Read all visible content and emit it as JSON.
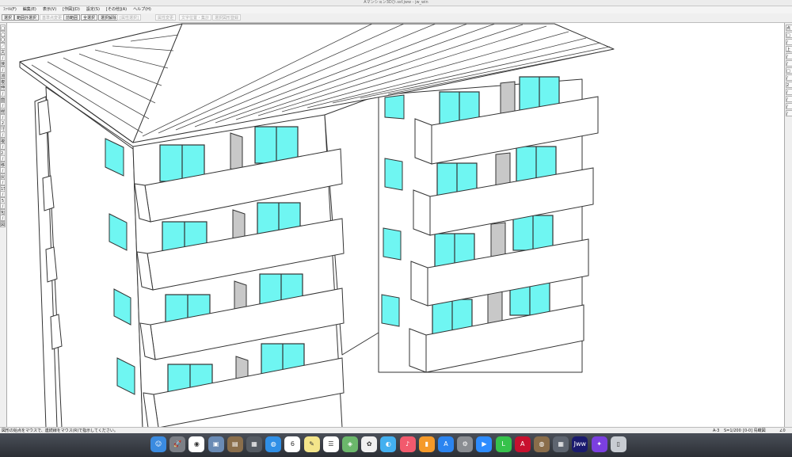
{
  "window": {
    "title": "Aマンション3Dひ.ssf.jww - jw_win"
  },
  "menu": [
    "ﾌｧｲﾙ(F)",
    "編集(E)",
    "表示(V)",
    "[作図](D)",
    "設定(S)",
    "[その他](A)",
    "ヘルプ(H)"
  ],
  "toolbar": {
    "items": [
      {
        "label": "選択",
        "disabled": false
      },
      {
        "label": "範囲外選択",
        "disabled": false
      },
      {
        "label": "基準点変更",
        "disabled": true
      },
      {
        "label": "前範囲",
        "disabled": false
      },
      {
        "label": "全選択",
        "disabled": false
      },
      {
        "label": "選択解除",
        "disabled": false
      },
      {
        "label": "[属性選択]",
        "disabled": true
      },
      {
        "label": "属性変更",
        "disabled": true
      },
      {
        "label": "文字位置・集計",
        "disabled": true
      },
      {
        "label": "選択図形登録",
        "disabled": true
      }
    ]
  },
  "left_tools": [
    "□",
    "◯",
    "〇",
    "／",
    "文",
    "/",
    "接",
    "/",
    "消",
    "複",
    "伸",
    "/",
    "面",
    "/",
    "線",
    "/",
    "2",
    "寸",
    "/",
    "複",
    "/",
    "2.5",
    "/",
    "移",
    "/",
    "戻",
    "/",
    "15",
    "/",
    "5",
    "/",
    "包",
    "/",
    "図"
  ],
  "right_tools": [
    "点",
    "□",
    "/",
    "上",
    "/",
    "/",
    "□",
    "/",
    "2",
    "/",
    "/",
    "/",
    "/"
  ],
  "status": {
    "message": "図形の始点をマウスで、連続線をマウス(R)で指示してください。",
    "scale": "A-3",
    "scale_ratio": "S=1/200",
    "layer": "[0-0] 鳥瞰図",
    "angle": "∠0"
  },
  "dock": {
    "apps": [
      {
        "name": "finder-icon",
        "label": "☺",
        "color": "#3b8be0"
      },
      {
        "name": "launchpad-icon",
        "label": "🚀",
        "color": "#7c7f86"
      },
      {
        "name": "chrome-icon",
        "label": "◉",
        "color": "#ffffff"
      },
      {
        "name": "preview-icon",
        "label": "▣",
        "color": "#6a8bb5"
      },
      {
        "name": "notes-icon",
        "label": "▤",
        "color": "#8a6e4b"
      },
      {
        "name": "doc-icon",
        "label": "▦",
        "color": "#555b63"
      },
      {
        "name": "safari-icon",
        "label": "◍",
        "color": "#2f8fe6"
      },
      {
        "name": "calendar-icon",
        "label": "6",
        "color": "#ffffff"
      },
      {
        "name": "notes2-icon",
        "label": "✎",
        "color": "#f4e58a"
      },
      {
        "name": "reminders-icon",
        "label": "☰",
        "color": "#ffffff"
      },
      {
        "name": "maps-icon",
        "label": "◈",
        "color": "#6bb76b"
      },
      {
        "name": "photos-icon",
        "label": "✿",
        "color": "#f0f0f0"
      },
      {
        "name": "messages-icon",
        "label": "◐",
        "color": "#43b0f0"
      },
      {
        "name": "music-icon",
        "label": "♪",
        "color": "#f25a6d"
      },
      {
        "name": "books-icon",
        "label": "▮",
        "color": "#f59a2a"
      },
      {
        "name": "appstore-icon",
        "label": "A",
        "color": "#2b84f0"
      },
      {
        "name": "settings-icon",
        "label": "⚙",
        "color": "#8a8d92"
      },
      {
        "name": "zoom-icon",
        "label": "▶",
        "color": "#2d8cff"
      },
      {
        "name": "line-icon",
        "label": "L",
        "color": "#36c24b"
      },
      {
        "name": "autocad-icon",
        "label": "A",
        "color": "#c8102e"
      },
      {
        "name": "sketch-icon",
        "label": "◍",
        "color": "#8a6d4a"
      },
      {
        "name": "utility-icon",
        "label": "▦",
        "color": "#5e6570"
      },
      {
        "name": "jww-icon",
        "label": "Jww",
        "color": "#1a1a6e"
      },
      {
        "name": "magic-icon",
        "label": "✦",
        "color": "#7b3fe0"
      },
      {
        "name": "trash-icon",
        "label": "▯",
        "color": "#c8ccd2"
      }
    ]
  },
  "colors": {
    "window_glass": "#6ff6f2",
    "frame": "#333333",
    "shade": "#c8c8c8"
  }
}
